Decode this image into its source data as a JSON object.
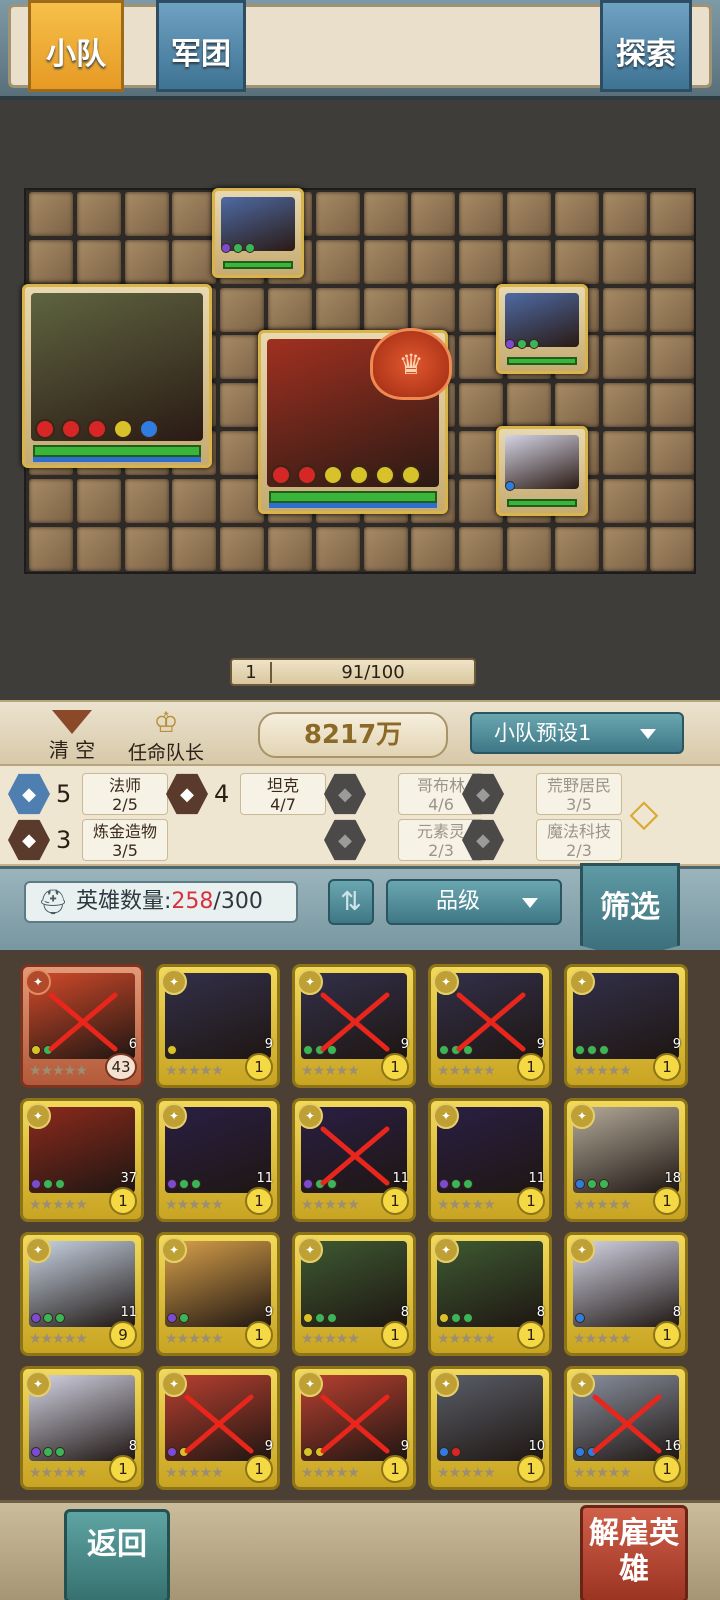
{
  "top_tabs": {
    "squad": "小队",
    "legion": "军团",
    "explore": "探索"
  },
  "battle": {
    "level": "1",
    "exp": "91/100",
    "units": [
      {
        "name": "golem",
        "art": "#5e6440",
        "gems": [
          "#d62626",
          "#d62626",
          "#d62626",
          "#d7c22a",
          "#2f7de0"
        ]
      },
      {
        "name": "bear",
        "art": "#a03020",
        "gems": [
          "#d62626",
          "#d62626",
          "#d7c22a",
          "#d7c22a",
          "#d7c22a",
          "#d7c22a"
        ]
      },
      {
        "name": "mage-a",
        "art": "#4e6aa4",
        "gems": [
          "#7b4bd3",
          "#3bb55a",
          "#3bb55a"
        ]
      },
      {
        "name": "mage-b",
        "art": "#4e6aa4",
        "gems": [
          "#7b4bd3",
          "#3bb55a",
          "#3bb55a"
        ]
      },
      {
        "name": "priestess",
        "art": "#d4d4e4",
        "gems": [
          "#2f7de0"
        ]
      }
    ]
  },
  "controls": {
    "clear": "清 空",
    "captain": "任命队长",
    "power": "8217万",
    "preset": "小队预设1"
  },
  "synergies": [
    {
      "count": "5",
      "name": "法师",
      "progress": "2/5",
      "color": "#4f7fb0",
      "icon": "mage-icon"
    },
    {
      "count": "4",
      "name": "坦克",
      "progress": "4/7",
      "color": "#5a3a2a",
      "icon": "shield-icon"
    },
    {
      "count": "",
      "name": "哥布林",
      "progress": "4/6",
      "color": "#4b4a48",
      "icon": "goblin-icon"
    },
    {
      "count": "",
      "name": "荒野居民",
      "progress": "3/5",
      "color": "#4b4a48",
      "icon": "wild-icon"
    },
    {
      "count": "3",
      "name": "炼金造物",
      "progress": "3/5",
      "color": "#5a3a2a",
      "icon": "flask-icon"
    },
    {
      "count": "",
      "name": "元素灵",
      "progress": "2/3",
      "color": "#4b4a48",
      "icon": "element-icon"
    },
    {
      "count": "",
      "name": "魔法科技",
      "progress": "2/3",
      "color": "#4b4a48",
      "icon": "tech-icon"
    }
  ],
  "hero_list": {
    "count_label": "英雄数量:",
    "count_current": "258",
    "count_total": "/300",
    "sort_label": "品级",
    "filter_label": "筛选"
  },
  "heroes": [
    {
      "cost": "6",
      "level": "43",
      "art": "#d24a2a",
      "red": true,
      "x": true,
      "gems": [
        "#d7c22a",
        "#3bb55a"
      ]
    },
    {
      "cost": "9",
      "level": "1",
      "art": "#33304a",
      "red": false,
      "x": false,
      "gems": [
        "#d7c22a"
      ]
    },
    {
      "cost": "9",
      "level": "1",
      "art": "#33304a",
      "red": false,
      "x": true,
      "gems": [
        "#3bb55a",
        "#3bb55a",
        "#3bb55a"
      ]
    },
    {
      "cost": "9",
      "level": "1",
      "art": "#33304a",
      "red": false,
      "x": true,
      "gems": [
        "#3bb55a",
        "#3bb55a",
        "#3bb55a"
      ]
    },
    {
      "cost": "9",
      "level": "1",
      "art": "#33304a",
      "red": false,
      "x": false,
      "gems": [
        "#3bb55a",
        "#3bb55a",
        "#3bb55a"
      ]
    },
    {
      "cost": "37",
      "level": "1",
      "art": "#8c2a1c",
      "red": false,
      "x": false,
      "gems": [
        "#7b4bd3",
        "#3bb55a",
        "#3bb55a"
      ]
    },
    {
      "cost": "11",
      "level": "1",
      "art": "#2a1f44",
      "red": false,
      "x": false,
      "gems": [
        "#7b4bd3",
        "#3bb55a",
        "#3bb55a"
      ]
    },
    {
      "cost": "11",
      "level": "1",
      "art": "#2a1f44",
      "red": false,
      "x": true,
      "gems": [
        "#7b4bd3",
        "#3bb55a",
        "#3bb55a"
      ]
    },
    {
      "cost": "11",
      "level": "1",
      "art": "#2a1f44",
      "red": false,
      "x": false,
      "gems": [
        "#7b4bd3",
        "#3bb55a",
        "#3bb55a"
      ]
    },
    {
      "cost": "18",
      "level": "1",
      "art": "#b4aa9a",
      "red": false,
      "x": false,
      "gems": [
        "#2f7de0",
        "#3bb55a",
        "#3bb55a"
      ]
    },
    {
      "cost": "11",
      "level": "9",
      "art": "#c8d4e4",
      "red": false,
      "x": false,
      "gems": [
        "#7b4bd3",
        "#3bb55a",
        "#3bb55a"
      ]
    },
    {
      "cost": "9",
      "level": "1",
      "art": "#d8a04a",
      "red": false,
      "x": false,
      "gems": [
        "#7b4bd3",
        "#3bb55a"
      ]
    },
    {
      "cost": "8",
      "level": "1",
      "art": "#3e5a32",
      "red": false,
      "x": false,
      "gems": [
        "#d7c22a",
        "#3bb55a",
        "#3bb55a"
      ]
    },
    {
      "cost": "8",
      "level": "1",
      "art": "#3e5a32",
      "red": false,
      "x": false,
      "gems": [
        "#d7c22a",
        "#3bb55a",
        "#3bb55a"
      ]
    },
    {
      "cost": "8",
      "level": "1",
      "art": "#d4d4e4",
      "red": false,
      "x": false,
      "gems": [
        "#2f7de0"
      ]
    },
    {
      "cost": "8",
      "level": "1",
      "art": "#d4d4e4",
      "red": false,
      "x": false,
      "gems": [
        "#7b4bd3",
        "#3bb55a",
        "#3bb55a"
      ]
    },
    {
      "cost": "9",
      "level": "1",
      "art": "#b84030",
      "red": false,
      "x": true,
      "gems": [
        "#7b4bd3",
        "#d7c22a"
      ]
    },
    {
      "cost": "9",
      "level": "1",
      "art": "#b84030",
      "red": false,
      "x": true,
      "gems": [
        "#d7c22a",
        "#d7c22a"
      ]
    },
    {
      "cost": "10",
      "level": "1",
      "art": "#5a5e68",
      "red": false,
      "x": false,
      "gems": [
        "#2f7de0",
        "#d62626"
      ]
    },
    {
      "cost": "16",
      "level": "1",
      "art": "#8a909e",
      "red": false,
      "x": true,
      "gems": [
        "#2f7de0",
        "#2f7de0"
      ]
    }
  ],
  "bottom": {
    "back": "返回",
    "dismiss": "解雇英雄"
  }
}
